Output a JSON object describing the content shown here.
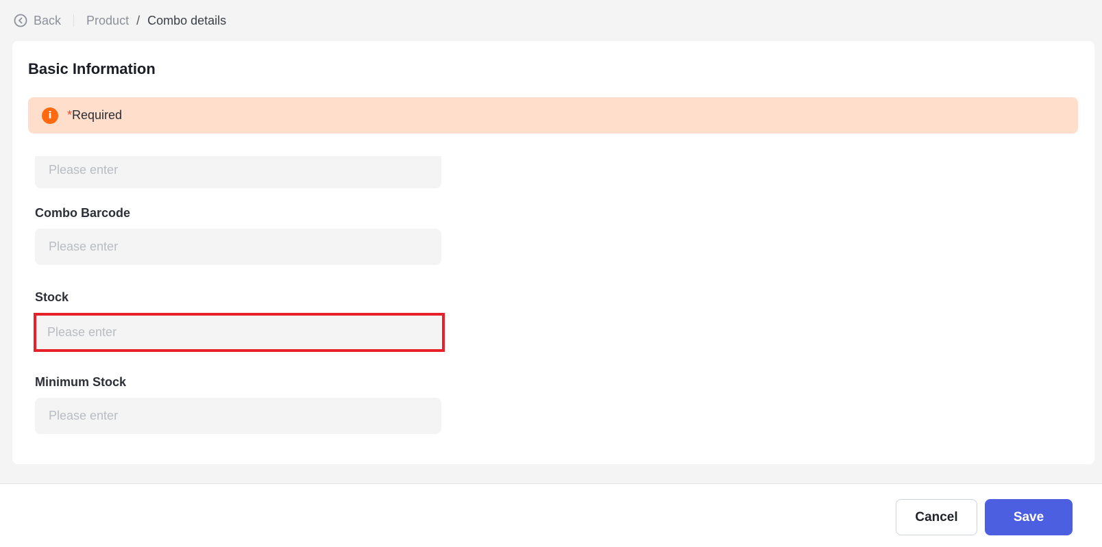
{
  "breadcrumb": {
    "back_label": "Back",
    "parent": "Product",
    "separator": "/",
    "current": "Combo details"
  },
  "section": {
    "title": "Basic Information",
    "notice": {
      "star": "*",
      "text": "Required",
      "icon": "info-icon",
      "icon_glyph": "i"
    }
  },
  "fields": [
    {
      "label": "",
      "placeholder": "Please enter",
      "value": ""
    },
    {
      "label": "Combo Barcode",
      "placeholder": "Please enter",
      "value": ""
    },
    {
      "label": "Stock",
      "placeholder": "Please enter",
      "value": "",
      "highlighted": true
    },
    {
      "label": "Minimum Stock",
      "placeholder": "Please enter",
      "value": ""
    }
  ],
  "footer": {
    "cancel_label": "Cancel",
    "save_label": "Save"
  },
  "colors": {
    "accent": "#4c5fe0",
    "notice_bg": "#ffdfcc",
    "notice_icon": "#ff6a10",
    "highlight_border": "#e8202a"
  }
}
